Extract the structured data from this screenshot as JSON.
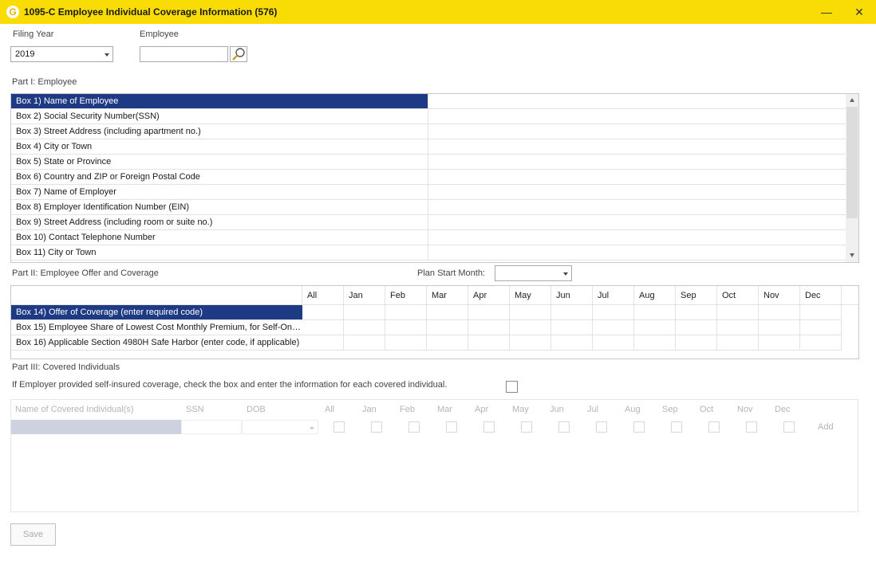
{
  "window": {
    "title": "1095-C Employee Individual Coverage Information (576)",
    "app_icon": "G",
    "minimize": "—",
    "close": "✕"
  },
  "filing_year": {
    "label": "Filing Year",
    "value": "2019"
  },
  "employee": {
    "label": "Employee",
    "value": ""
  },
  "part1": {
    "label": "Part I: Employee",
    "rows": [
      "Box 1) Name of Employee",
      "Box 2) Social Security Number(SSN)",
      "Box 3) Street Address (including apartment no.)",
      "Box 4) City or Town",
      "Box 5) State or Province",
      "Box 6) Country and ZIP or Foreign Postal Code",
      "Box 7) Name of Employer",
      "Box 8) Employer Identification Number (EIN)",
      "Box 9) Street Address (including room or suite no.)",
      "Box 10) Contact Telephone Number",
      "Box 11) City or Town"
    ]
  },
  "part2": {
    "label": "Part II: Employee Offer and Coverage",
    "plan_start_label": "Plan Start Month:",
    "plan_start_value": "",
    "months": [
      "All",
      "Jan",
      "Feb",
      "Mar",
      "Apr",
      "May",
      "Jun",
      "Jul",
      "Aug",
      "Sep",
      "Oct",
      "Nov",
      "Dec"
    ],
    "rows": [
      "Box 14) Offer of Coverage (enter required code)",
      "Box 15) Employee Share of Lowest Cost Monthly Premium, for Self-Only...",
      "Box 16) Applicable Section 4980H Safe Harbor (enter code, if applicable)"
    ]
  },
  "part3": {
    "label": "Part III: Covered Individuals",
    "note": "If Employer provided self-insured coverage, check the box and enter the information for each covered individual.",
    "columns": {
      "name": "Name of Covered Individual(s)",
      "ssn": "SSN",
      "dob": "DOB"
    },
    "add_label": "Add"
  },
  "save_label": "Save",
  "colors": {
    "titlebar": "#f9dc04",
    "selection": "#1f3a84"
  }
}
